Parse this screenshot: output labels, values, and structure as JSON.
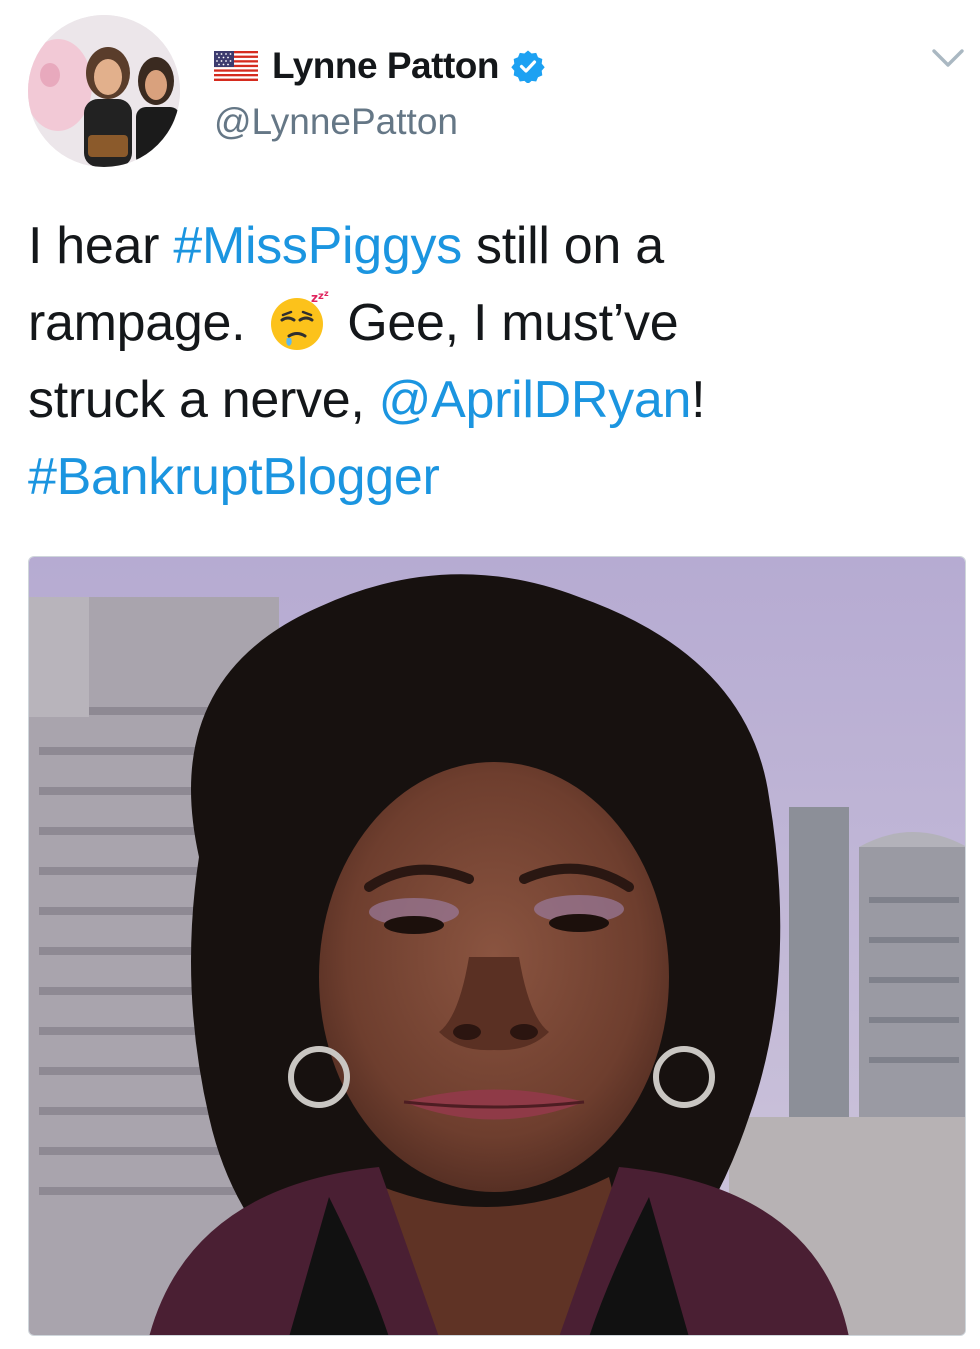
{
  "author": {
    "display_name": "Lynne Patton",
    "handle": "@LynnePatton",
    "flag_icon": "us-flag-icon",
    "verified": true,
    "verified_icon": "verified-badge-icon",
    "verified_color": "#1da1f2"
  },
  "tweet": {
    "line1_pre": "I hear ",
    "hashtag_misspiggys": "#MissPiggys",
    "line1_post": " still on a",
    "line2_pre": "rampage.",
    "emoji": "sleepy-face-icon",
    "line2_post": "Gee, I must’ve",
    "line3_pre": "struck a nerve, ",
    "mention_april": "@AprilDRyan",
    "line3_post": "!",
    "hashtag_bankrupt": "#BankruptBlogger"
  },
  "menu": {
    "caret_icon": "chevron-down-icon"
  },
  "colors": {
    "link": "#1b95e0",
    "text": "#14171a",
    "secondary": "#657786"
  }
}
